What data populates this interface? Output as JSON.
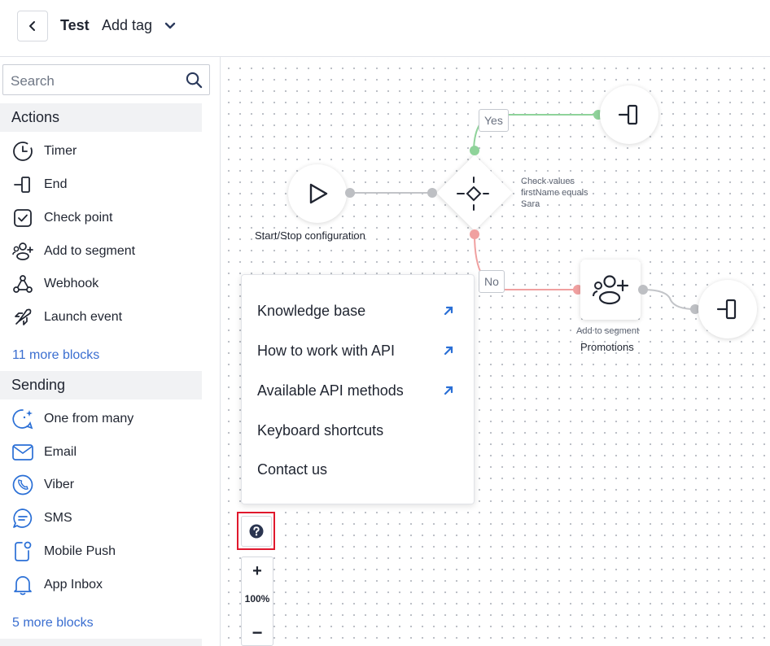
{
  "header": {
    "title": "Test",
    "subtitle": "Add tag"
  },
  "sidebar": {
    "search_placeholder": "Search",
    "sections": {
      "actions": {
        "title": "Actions",
        "items": [
          "Timer",
          "End",
          "Check point",
          "Add to segment",
          "Webhook",
          "Launch event"
        ],
        "more": "11 more blocks"
      },
      "sending": {
        "title": "Sending",
        "items": [
          "One from many",
          "Email",
          "Viber",
          "SMS",
          "Mobile Push",
          "App Inbox"
        ],
        "more": "5 more blocks"
      }
    }
  },
  "canvas": {
    "start_label": "Start/Stop configuration",
    "condition": {
      "line1": "Check values",
      "line2": "firstName equals",
      "line3": "Sara"
    },
    "branch_yes": "Yes",
    "branch_no": "No",
    "segment": {
      "caption": "Add to segment",
      "name": "Promotions"
    },
    "colors": {
      "yes": "#8fd39a",
      "no": "#f0a0a0",
      "neutral": "#c2c4c8"
    }
  },
  "help_menu": {
    "items": [
      {
        "label": "Knowledge base",
        "external": true
      },
      {
        "label": "How to work with API",
        "external": true
      },
      {
        "label": "Available API methods",
        "external": true
      },
      {
        "label": "Keyboard shortcuts",
        "external": false
      },
      {
        "label": "Contact us",
        "external": false
      }
    ]
  },
  "zoom": {
    "level": "100%",
    "in_label": "+",
    "out_label": "−"
  }
}
